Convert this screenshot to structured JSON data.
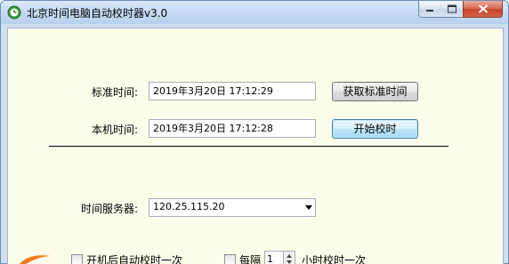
{
  "window": {
    "title": "北京时间电脑自动校时器v3.0"
  },
  "main": {
    "standard_time_label": "标准时间:",
    "standard_time_value": "2019年3月20日  17:12:29",
    "get_standard_time_button": "获取标准时间",
    "local_time_label": "本机时间:",
    "local_time_value": "2019年3月20日  17:12:28",
    "start_sync_button": "开始校时",
    "server_label": "时间服务器:",
    "server_value": "120.25.115.20"
  },
  "options": {
    "startup_sync_label": "开机后自动校时一次",
    "interval_prefix": "每隔",
    "interval_value": "1",
    "interval_suffix": "小时校时一次"
  },
  "colors": {
    "client_bg": "#fcfcea",
    "title_bar": "#c6dbf3",
    "close_button": "#c4442a"
  }
}
